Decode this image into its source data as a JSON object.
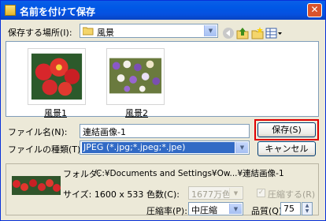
{
  "window": {
    "title": "名前を付けて保存",
    "close_glyph": "✕"
  },
  "save_location": {
    "label": "保存する場所(I):",
    "value": "風景"
  },
  "toolbar_icons": [
    "back-arrow-icon",
    "up-folder-icon",
    "new-folder-icon",
    "view-menu-icon"
  ],
  "files": [
    {
      "name": "風景1"
    },
    {
      "name": "風景2"
    }
  ],
  "filename": {
    "label": "ファイル名(N):",
    "value": "連結画像-1"
  },
  "filetype": {
    "label": "ファイルの種類(T):",
    "value": "JPEG (*.jpg;*.jpeg;*.jpe)"
  },
  "buttons": {
    "save": "保存(S)",
    "cancel": "キャンセル"
  },
  "info": {
    "folder_label": "フォルダ:",
    "folder_path": "C:¥Documents and Settings¥Ow...¥連結画像-1",
    "size_label": "サイズ: 1600 x 533",
    "colors_label": "色数(C):",
    "colors_value": "1677万色",
    "compress_checkbox": "圧縮する(R)",
    "ratio_label": "圧縮率(P):",
    "ratio_value": "中圧縮",
    "quality_label": "品質(Q):",
    "quality_value": "75"
  },
  "colors": {
    "title_bar": "#0058e6",
    "close": "#d9532b",
    "highlight": "#e00000",
    "selection": "#316ac5"
  }
}
